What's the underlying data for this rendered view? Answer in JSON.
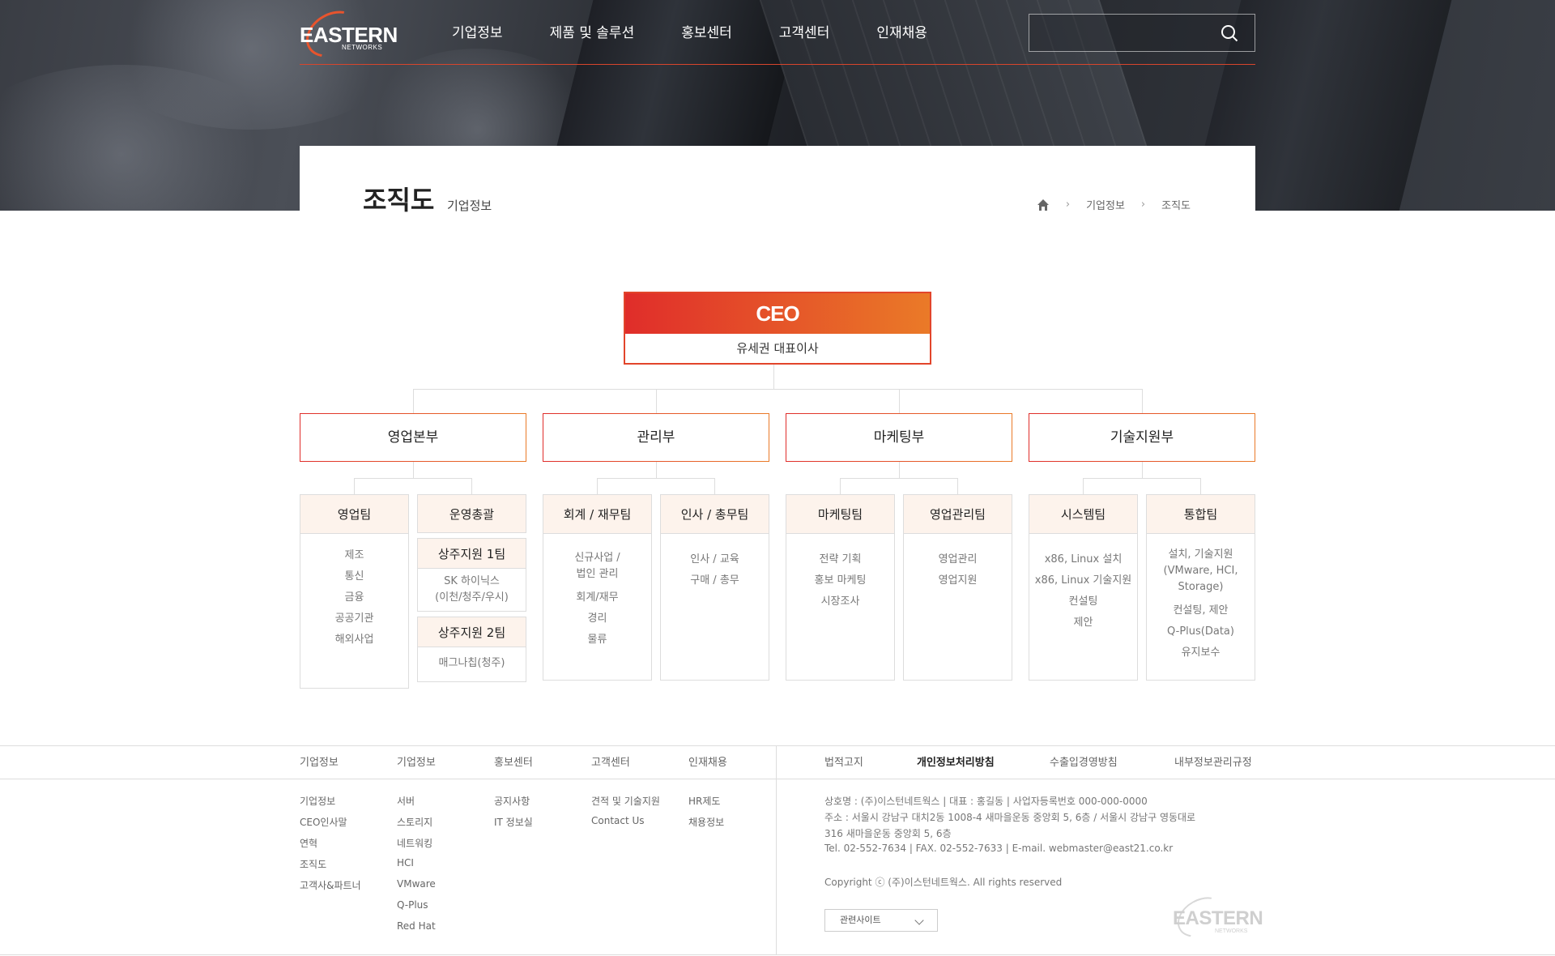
{
  "header": {
    "logo_main": "EASTERN",
    "logo_sub": "NETWORKS",
    "nav": [
      "기업정보",
      "제품 및 솔루션",
      "홍보센터",
      "고객센터",
      "인재채용"
    ]
  },
  "title": {
    "main": "조직도",
    "sub": "기업정보",
    "breadcrumb": [
      "기업정보",
      "조직도"
    ]
  },
  "org": {
    "ceo_title": "CEO",
    "ceo_name": "유세권 대표이사",
    "departments": [
      "영업본부",
      "관리부",
      "마케팅부",
      "기술지원부"
    ],
    "teams": {
      "sales": {
        "title": "영업팀",
        "items": [
          "제조",
          "통신",
          "금융",
          "공공기관",
          "해외사업"
        ]
      },
      "ops": {
        "title": "운영총괄",
        "sub1_title": "상주지원 1팀",
        "sub1_items": [
          "SK 하이닉스",
          "(이천/청주/우시)"
        ],
        "sub2_title": "상주지원 2팀",
        "sub2_items": [
          "매그나칩(청주)"
        ]
      },
      "acct": {
        "title": "회계 / 재무팀",
        "items": [
          "신규사업 /",
          "법인 관리",
          "회계/재무",
          "경리",
          "물류"
        ]
      },
      "hr": {
        "title": "인사 / 총무팀",
        "items": [
          "인사 / 교육",
          "구매 / 총무"
        ]
      },
      "mkt": {
        "title": "마케팅팀",
        "items": [
          "전략 기획",
          "홍보 마케팅",
          "시장조사"
        ]
      },
      "salesmgmt": {
        "title": "영업관리팀",
        "items": [
          "영업관리",
          "영업지원"
        ]
      },
      "sys": {
        "title": "시스템팀",
        "items": [
          "x86, Linux 설치",
          "x86, Linux 기술지원",
          "컨설팅",
          "제안"
        ]
      },
      "integ": {
        "title": "통합팀",
        "items": [
          "설치, 기술지원",
          "(VMware, HCI,",
          "Storage)",
          "컨설팅, 제안",
          "Q-Plus(Data)",
          "유지보수"
        ]
      }
    }
  },
  "footer": {
    "categories": [
      "기업정보",
      "기업정보",
      "홍보센터",
      "고객센터",
      "인재채용"
    ],
    "col1": [
      "기업정보",
      "CEO인사말",
      "연혁",
      "조직도",
      "고객사&파트너"
    ],
    "col2": [
      "서버",
      "스토리지",
      "네트워킹",
      "HCI",
      "VMware",
      "Q-Plus",
      "Red Hat"
    ],
    "col3": [
      "공지사항",
      "IT 정보실"
    ],
    "col4": [
      "견적 및 기술지원",
      "Contact Us"
    ],
    "col5": [
      "HR제도",
      "채용정보"
    ],
    "policies": [
      "법적고지",
      "개인정보처리방침",
      "수출입경영방침",
      "내부정보관리규정"
    ],
    "info": [
      "상호명 : (주)이스턴네트웍스  |  대표 : 홍길동  |  사업자등록번호 000-000-0000",
      "주소 : 서울시 강남구 대치2동 1008-4 새마을운동 중앙회 5, 6층 / 서울시 강남구 영동대로",
      "316 새마을운동 중앙회 5, 6층",
      "Tel. 02-552-7634  |  FAX. 02-552-7633  |  E-mail. webmaster@east21.co.kr"
    ],
    "copyright": "Copyright ⓒ (주)이스턴네트웍스. All rights reserved",
    "related_sites": "관련사이트",
    "logo_main": "EASTERN",
    "logo_sub": "NETWORKS"
  }
}
